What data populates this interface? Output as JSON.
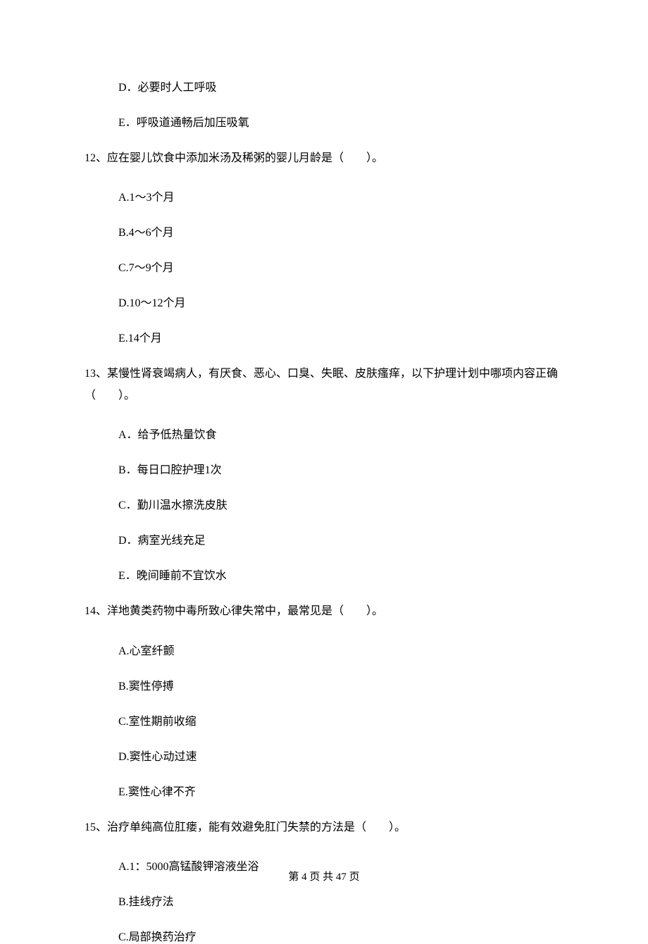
{
  "items": [
    {
      "kind": "option",
      "text": "D．必要时人工呼吸"
    },
    {
      "kind": "option",
      "text": "E．呼吸道通畅后加压吸氧"
    },
    {
      "kind": "question",
      "text": "12、应在婴儿饮食中添加米汤及稀粥的婴儿月龄是（　　）。"
    },
    {
      "kind": "option",
      "text": "A.1～3个月"
    },
    {
      "kind": "option",
      "text": "B.4～6个月"
    },
    {
      "kind": "option",
      "text": "C.7～9个月"
    },
    {
      "kind": "option",
      "text": "D.10～12个月"
    },
    {
      "kind": "option",
      "text": "E.14个月"
    },
    {
      "kind": "question",
      "text": "13、某慢性肾衰竭病人，有厌食、恶心、口臭、失眠、皮肤瘙痒，以下护理计划中哪项内容正确（　　）。"
    },
    {
      "kind": "option",
      "text": "A．给予低热量饮食"
    },
    {
      "kind": "option",
      "text": "B．每日口腔护理1次"
    },
    {
      "kind": "option",
      "text": "C．勤川温水擦洗皮肤"
    },
    {
      "kind": "option",
      "text": "D．病室光线充足"
    },
    {
      "kind": "option",
      "text": "E．晚间睡前不宜饮水"
    },
    {
      "kind": "question",
      "text": "14、洋地黄类药物中毒所致心律失常中，最常见是（　　）。"
    },
    {
      "kind": "option",
      "text": "A.心室纤颤"
    },
    {
      "kind": "option",
      "text": "B.窦性停搏"
    },
    {
      "kind": "option",
      "text": "C.室性期前收缩"
    },
    {
      "kind": "option",
      "text": "D.窦性心动过速"
    },
    {
      "kind": "option",
      "text": "E.窦性心律不齐"
    },
    {
      "kind": "question",
      "text": "15、治疗单纯高位肛瘘，能有效避免肛门失禁的方法是（　　）。"
    },
    {
      "kind": "option",
      "text": "A.1：5000高锰酸钾溶液坐浴"
    },
    {
      "kind": "option",
      "text": "B.挂线疗法"
    },
    {
      "kind": "option",
      "text": "C.局部换药治疗"
    }
  ],
  "footer": "第 4 页 共 47 页"
}
